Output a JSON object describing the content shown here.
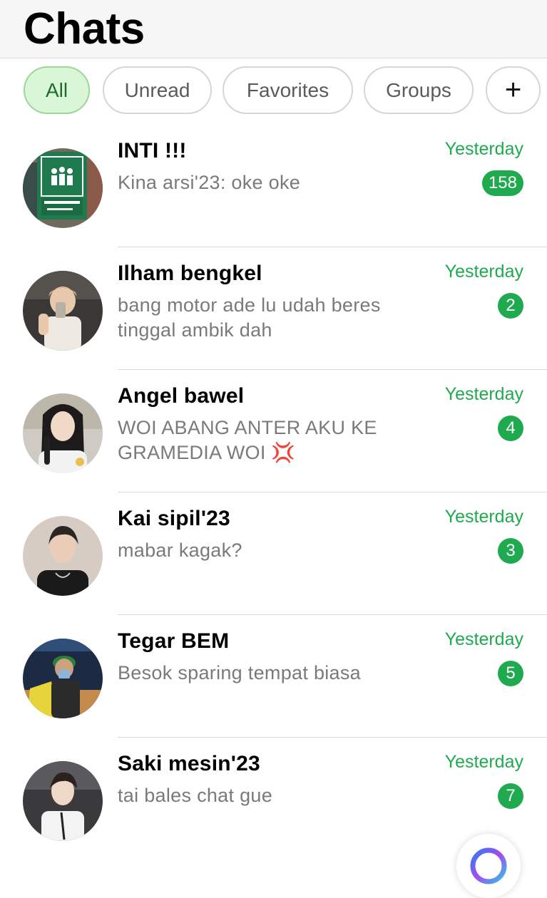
{
  "header": {
    "title": "Chats"
  },
  "filters": [
    {
      "label": "All",
      "active": true
    },
    {
      "label": "Unread",
      "active": false
    },
    {
      "label": "Favorites",
      "active": false
    },
    {
      "label": "Groups",
      "active": false
    },
    {
      "label": "+",
      "active": false
    }
  ],
  "chats": [
    {
      "name": "INTI !!!",
      "preview": "Kina arsi'23: oke oke",
      "time": "Yesterday",
      "unread": "158"
    },
    {
      "name": "Ilham bengkel",
      "preview": "bang motor ade lu udah beres tinggal ambik dah",
      "time": "Yesterday",
      "unread": "2"
    },
    {
      "name": "Angel bawel",
      "preview": "WOI ABANG ANTER AKU KE GRAMEDIA WOI 💢",
      "time": "Yesterday",
      "unread": "4"
    },
    {
      "name": "Kai sipil'23",
      "preview": "mabar kagak?",
      "time": "Yesterday",
      "unread": "3"
    },
    {
      "name": "Tegar BEM",
      "preview": "Besok sparing tempat biasa",
      "time": "Yesterday",
      "unread": "5"
    },
    {
      "name": "Saki mesin'23",
      "preview": "tai bales chat gue",
      "time": "Yesterday",
      "unread": "7"
    }
  ],
  "colors": {
    "accent": "#1faa4f",
    "chip_active_bg": "#d9f7d6",
    "header_bg": "#f6f6f6"
  },
  "icons": {
    "add_filter": "plus-icon",
    "fab": "meta-ai-icon"
  }
}
